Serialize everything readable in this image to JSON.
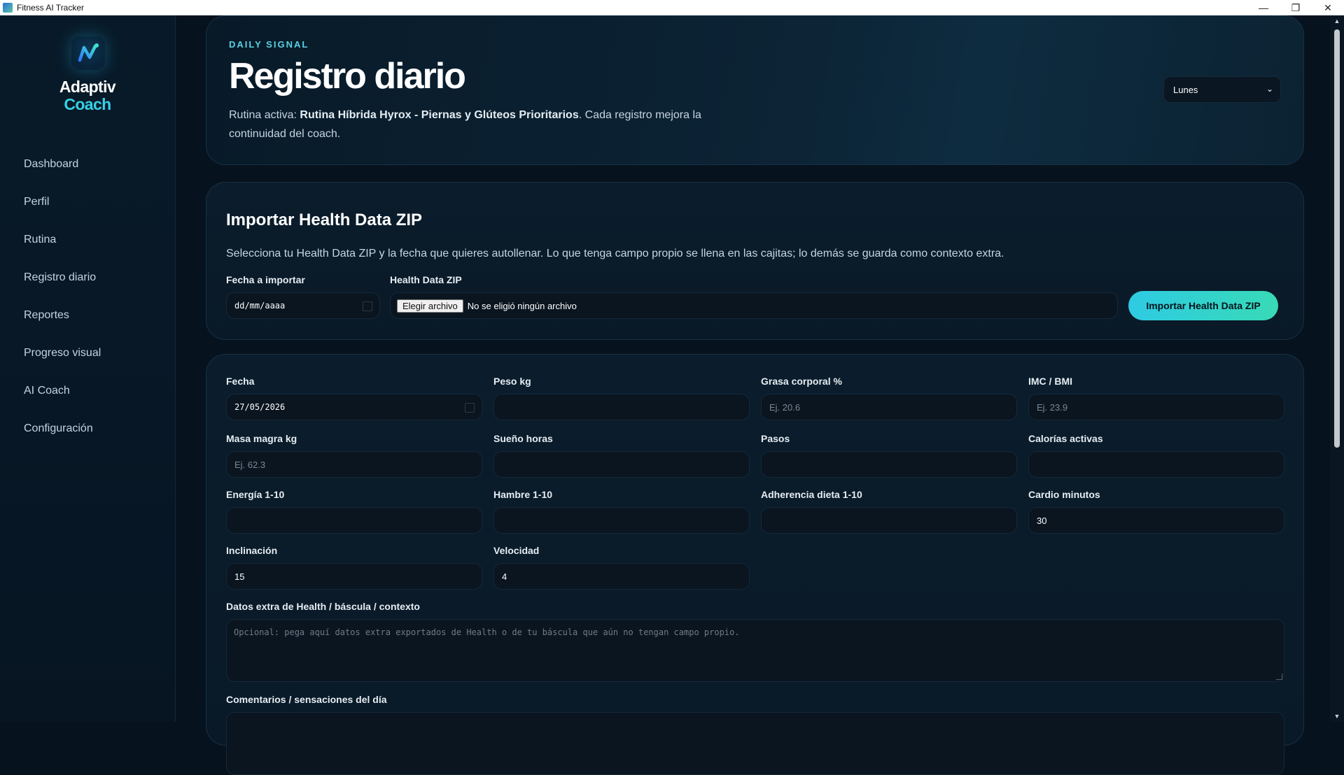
{
  "window": {
    "title": "Fitness AI Tracker",
    "controls": [
      "—",
      "❐",
      "✕"
    ]
  },
  "brand": {
    "line1": "Adaptiv",
    "line2": "Coach"
  },
  "nav": [
    {
      "label": "Dashboard"
    },
    {
      "label": "Perfil"
    },
    {
      "label": "Rutina"
    },
    {
      "label": "Registro diario"
    },
    {
      "label": "Reportes"
    },
    {
      "label": "Progreso visual"
    },
    {
      "label": "AI Coach"
    },
    {
      "label": "Configuración"
    }
  ],
  "hero": {
    "eyebrow": "DAILY SIGNAL",
    "title": "Registro diario",
    "desc_prefix": "Rutina activa: ",
    "routine": "Rutina Híbrida Hyrox - Piernas y Glúteos Prioritarios",
    "desc_suffix": ". Cada registro mejora la continuidad del coach.",
    "day_select": "Lunes"
  },
  "import": {
    "title": "Importar Health Data ZIP",
    "subtitle": "Selecciona tu Health Data ZIP y la fecha que quieres autollenar. Lo que tenga campo propio se llena en las cajitas; lo demás se guarda como contexto extra.",
    "date_label": "Fecha a importar",
    "date_placeholder": "dd/mm/aaaa",
    "zip_label": "Health Data ZIP",
    "file_button": "Elegir archivo",
    "file_status": "No se eligió ningún archivo",
    "submit": "Importar Health Data ZIP"
  },
  "form": {
    "fecha": {
      "label": "Fecha",
      "value": "27/05/2026"
    },
    "peso": {
      "label": "Peso kg",
      "value": ""
    },
    "grasa": {
      "label": "Grasa corporal %",
      "placeholder": "Ej. 20.6"
    },
    "imc": {
      "label": "IMC / BMI",
      "placeholder": "Ej. 23.9"
    },
    "masa": {
      "label": "Masa magra kg",
      "placeholder": "Ej. 62.3"
    },
    "sueno": {
      "label": "Sueño horas",
      "value": ""
    },
    "pasos": {
      "label": "Pasos",
      "value": ""
    },
    "calorias": {
      "label": "Calorías activas",
      "value": ""
    },
    "energia": {
      "label": "Energía 1-10",
      "value": ""
    },
    "hambre": {
      "label": "Hambre 1-10",
      "value": ""
    },
    "adherencia": {
      "label": "Adherencia dieta 1-10",
      "value": ""
    },
    "cardio": {
      "label": "Cardio minutos",
      "value": "30"
    },
    "inclinacion": {
      "label": "Inclinación",
      "value": "15"
    },
    "velocidad": {
      "label": "Velocidad",
      "value": "4"
    },
    "extra": {
      "label": "Datos extra de Health / báscula / contexto",
      "placeholder": "Opcional: pega aquí datos extra exportados de Health o de tu báscula que aún no tengan campo propio."
    },
    "comentarios": {
      "label": "Comentarios / sensaciones del día"
    }
  },
  "colors": {
    "accent": "#35d1e6",
    "button_from": "#2ecbe3",
    "button_to": "#38dab6",
    "bg": "#06121d"
  }
}
